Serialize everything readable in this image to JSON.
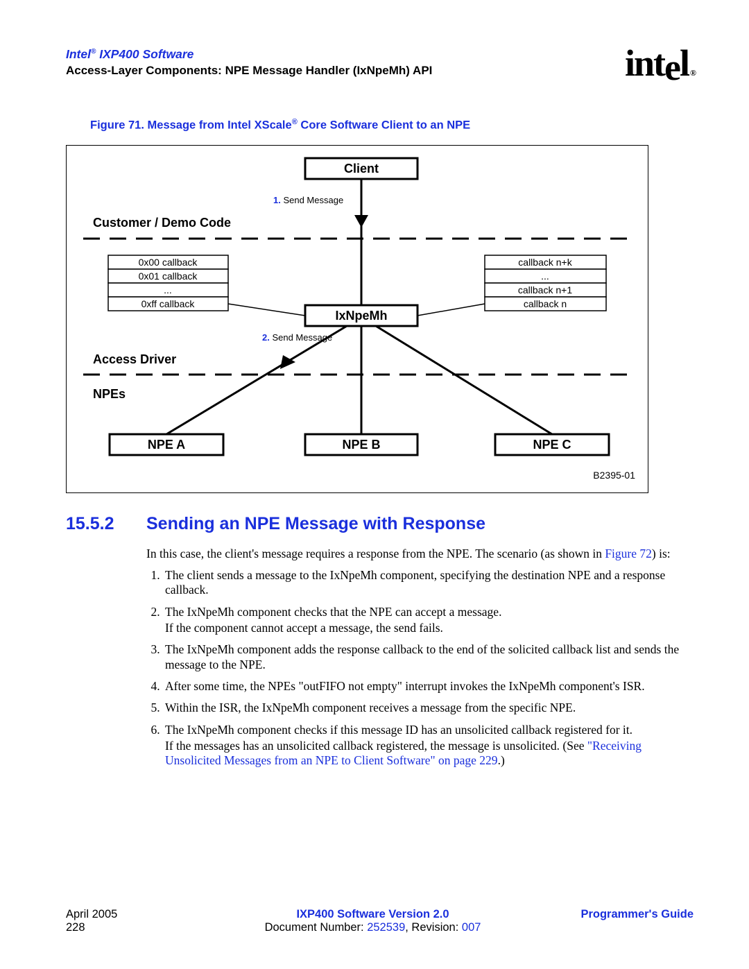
{
  "header": {
    "title_prefix": "Intel",
    "title_suffix": " IXP400 Software",
    "subtitle": "Access-Layer Components: NPE Message Handler (IxNpeMh) API",
    "logo_text": "intel",
    "logo_reg": "®"
  },
  "figure": {
    "caption_prefix": "Figure 71. Message from Intel XScale",
    "caption_suffix": " Core Software Client to an NPE",
    "client": "Client",
    "customer_demo": "Customer / Demo Code",
    "send_msg_1_num": "1.",
    "send_msg_1": " Send Message",
    "cb00": "0x00 callback",
    "cb01": "0x01 callback",
    "cbdots": "...",
    "cbff": "0xff callback",
    "ixnpemh": "IxNpeMh",
    "send_msg_2_num": "2.",
    "send_msg_2": " Send Message",
    "access_driver": "Access Driver",
    "cb_nk": "callback n+k",
    "cb_dots2": "...",
    "cb_n1": "callback n+1",
    "cb_n": "callback n",
    "npes": "NPEs",
    "npe_a": "NPE A",
    "npe_b": "NPE B",
    "npe_c": "NPE C",
    "id": "B2395-01"
  },
  "section": {
    "num": "15.5.2",
    "title": "Sending an NPE Message with Response",
    "intro_pre": "In this case, the client's message requires a response from the NPE. The scenario (as shown in ",
    "intro_link": "Figure 72",
    "intro_post": ") is:",
    "steps": [
      "The client sends a message to the IxNpeMh component, specifying the destination NPE and a response callback.",
      "",
      "The IxNpeMh component adds the response callback to the end of the solicited callback list and sends the message to the NPE.",
      "After some time, the NPEs \"outFIFO not empty\" interrupt invokes the IxNpeMh component's ISR.",
      "Within the ISR, the IxNpeMh component receives a message from the specific NPE.",
      ""
    ],
    "step2_a": "The IxNpeMh component checks that the NPE can accept a message.",
    "step2_b": "If the component cannot accept a message, the send fails.",
    "step6_a": "The IxNpeMh component checks if this message ID has an unsolicited callback registered for it.",
    "step6_b": "If the messages has an unsolicited callback registered, the message is unsolicited. (See ",
    "step6_link": "\"Receiving Unsolicited Messages from an NPE to Client Software\" on page 229",
    "step6_c": ".)"
  },
  "footer": {
    "date": "April 2005",
    "page": "228",
    "center1": "IXP400 Software Version 2.0",
    "center2_pre": "Document Number: ",
    "docnum": "252539",
    "center2_mid": ", Revision: ",
    "rev": "007",
    "right": "Programmer's Guide"
  }
}
